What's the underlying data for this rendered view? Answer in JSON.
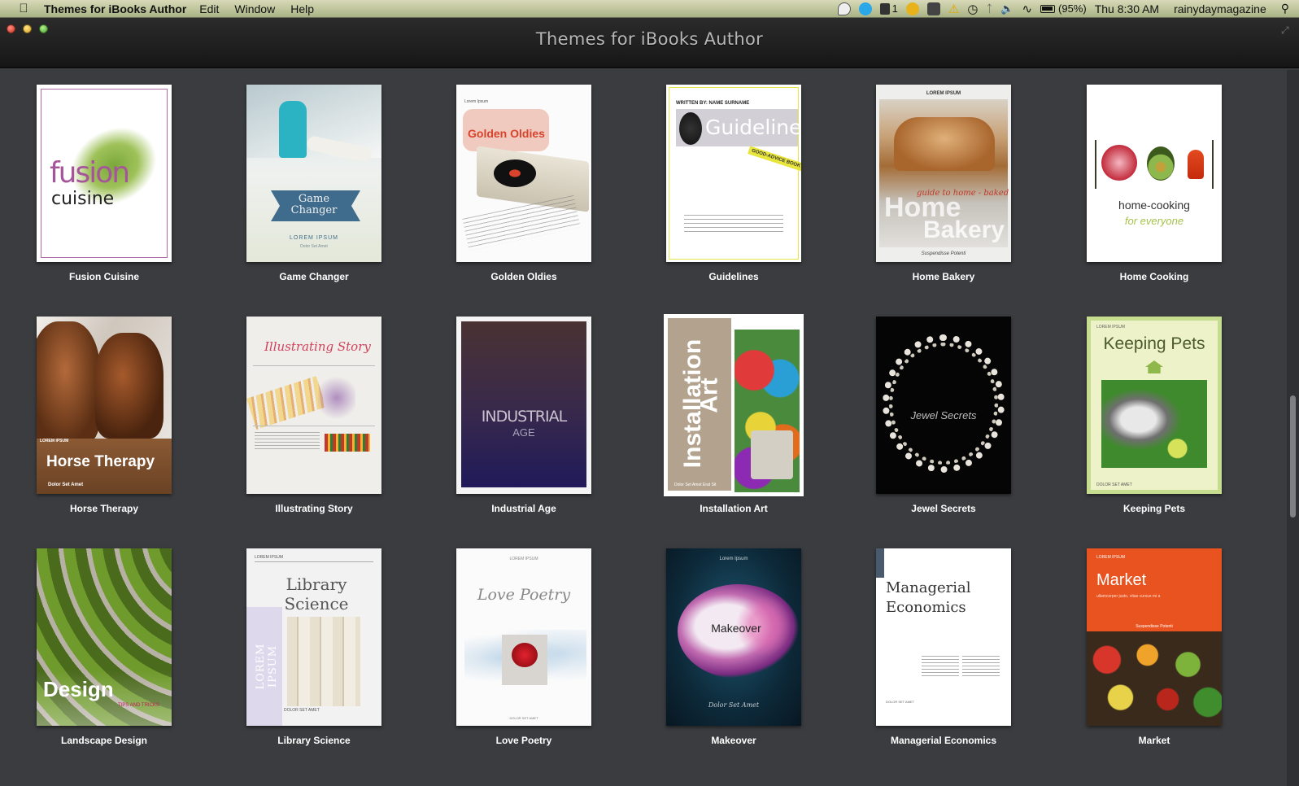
{
  "menubar": {
    "app_name": "Themes for iBooks Author",
    "menus": [
      "Edit",
      "Window",
      "Help"
    ],
    "status": {
      "notifications_count": "1",
      "battery": "(95%)",
      "clock": "Thu 8:30 AM",
      "user": "rainydaymagazine"
    }
  },
  "window": {
    "title": "Themes for iBooks Author"
  },
  "themes": [
    {
      "label": "Fusion Cuisine",
      "cover": {
        "line1": "fusion",
        "line2": "cuisine"
      }
    },
    {
      "label": "Game Changer",
      "cover": {
        "line1": "Game",
        "line2": "Changer",
        "sub": "LOREM IPSUM",
        "sub2": "Dolor Set Amet"
      }
    },
    {
      "label": "Golden Oldies",
      "cover": {
        "top": "Lorem Ipsum",
        "title": "Golden Oldies"
      }
    },
    {
      "label": "Guidelines",
      "cover": {
        "top": "WRITTEN BY: NAME SURNAME",
        "title": "Guidelines",
        "tag": "GOOD-ADVICE BOOK"
      }
    },
    {
      "label": "Home Bakery",
      "cover": {
        "top": "LOREM IPSUM",
        "sub": "guide to home - baked",
        "line1": "Home",
        "line2": "Bakery",
        "bottom": "Suspendisse Potenti"
      }
    },
    {
      "label": "Home Cooking",
      "cover": {
        "line1": "home-cooking",
        "line2": "for everyone"
      }
    },
    {
      "label": "Horse Therapy",
      "cover": {
        "top": "LOREM IPSUM",
        "title": "Horse Therapy",
        "bottom": "Dolor Set Amet"
      }
    },
    {
      "label": "Illustrating Story",
      "cover": {
        "title": "Illustrating Story"
      }
    },
    {
      "label": "Industrial Age",
      "cover": {
        "line1": "INDUSTRIAL",
        "line2": "AGE"
      }
    },
    {
      "label": "Installation Art",
      "cover": {
        "line1": "Installation",
        "line2": "Art",
        "bottom": "Dolor Set Amet Erat Sit"
      }
    },
    {
      "label": "Jewel Secrets",
      "cover": {
        "title": "Jewel Secrets"
      }
    },
    {
      "label": "Keeping Pets",
      "cover": {
        "top": "LOREM IPSUM",
        "title": "Keeping Pets",
        "bottom": "DOLOR SET AMET"
      }
    },
    {
      "label": "Landscape Design",
      "cover": {
        "title": "Design",
        "sub": "TIPS AND TRICKS"
      }
    },
    {
      "label": "Library Science",
      "cover": {
        "top": "LOREM IPSUM",
        "title": "Library Science",
        "side": "LOREM IPSUM",
        "bottom": "DOLOR SET AMET"
      }
    },
    {
      "label": "Love Poetry",
      "cover": {
        "top": "LOREM IPSUM",
        "title": "Love Poetry",
        "bottom": "DOLOR SET AMET"
      }
    },
    {
      "label": "Makeover",
      "cover": {
        "top": "Lorem Ipsum",
        "title": "Makeover",
        "bottom": "Dolor Set Amet"
      }
    },
    {
      "label": "Managerial Economics",
      "cover": {
        "line1": "Managerial",
        "line2": "Economics",
        "bottom": "DOLOR SET AMET"
      }
    },
    {
      "label": "Market",
      "cover": {
        "top": "LOREM IPSUM",
        "title": "Market",
        "sub": "ullamcorper justo, vitae cursus mi a",
        "sub2": "Suspendisse Potenti"
      }
    }
  ],
  "selected_theme": "Installation Art"
}
